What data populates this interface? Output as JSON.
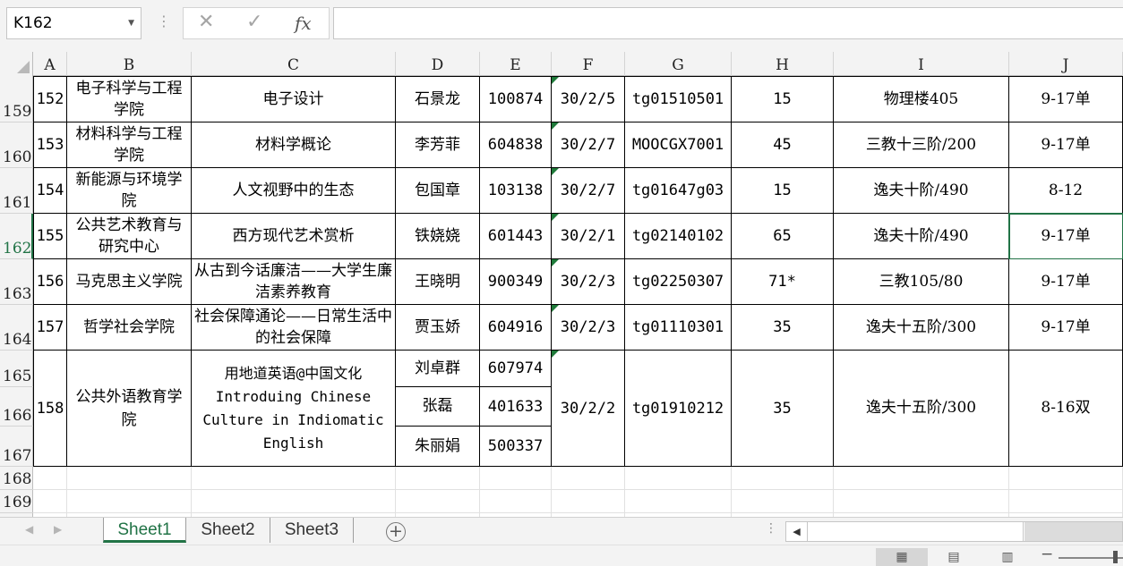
{
  "formula_bar": {
    "name_box": "K162",
    "cancel_icon": "✕",
    "enter_icon": "✓",
    "fx_label": "fx",
    "formula": ""
  },
  "columns": [
    "A",
    "B",
    "C",
    "D",
    "E",
    "F",
    "G",
    "H",
    "I",
    "J"
  ],
  "rows": [
    "159",
    "160",
    "161",
    "162",
    "163",
    "164",
    "165",
    "166",
    "167",
    "168",
    "169"
  ],
  "table": [
    {
      "A": "152",
      "B": "电子科学与工程学院",
      "C": "电子设计",
      "D": "石景龙",
      "E": "100874",
      "F": "30/2/5",
      "G": "tg01510501",
      "H": "15",
      "I": "物理楼405",
      "J": "9-17单"
    },
    {
      "A": "153",
      "B": "材料科学与工程学院",
      "C": "材料学概论",
      "D": "李芳菲",
      "E": "604838",
      "F": "30/2/7",
      "G": "MOOCGX7001",
      "H": "45",
      "I": "三教十三阶/200",
      "J": "9-17单"
    },
    {
      "A": "154",
      "B": "新能源与环境学院",
      "C": "人文视野中的生态",
      "D": "包国章",
      "E": "103138",
      "F": "30/2/7",
      "G": "tg01647g03",
      "H": "15",
      "I": "逸夫十阶/490",
      "J": "8-12"
    },
    {
      "A": "155",
      "B": "公共艺术教育与研究中心",
      "C": "西方现代艺术赏析",
      "D": "铁娆娆",
      "E": "601443",
      "F": "30/2/1",
      "G": "tg02140102",
      "H": "65",
      "I": "逸夫十阶/490",
      "J": "9-17单"
    },
    {
      "A": "156",
      "B": "马克思主义学院",
      "C": "从古到今话廉洁——大学生廉洁素养教育",
      "D": "王晓明",
      "E": "900349",
      "F": "30/2/3",
      "G": "tg02250307",
      "H": "71*",
      "I": "三教105/80",
      "J": "9-17单"
    },
    {
      "A": "157",
      "B": "哲学社会学院",
      "C": "社会保障通论——日常生活中的社会保障",
      "D": "贾玉娇",
      "E": "604916",
      "F": "30/2/3",
      "G": "tg01110301",
      "H": "35",
      "I": "逸夫十五阶/300",
      "J": "9-17单"
    },
    {
      "A": "158",
      "B": "公共外语教育学院",
      "C": "用地道英语@中国文化 Introduing Chinese Culture in Indiomatic English",
      "D": [
        "刘卓群",
        "张磊",
        "朱丽娟"
      ],
      "E": [
        "607974",
        "401633",
        "500337"
      ],
      "F": "30/2/2",
      "G": "tg01910212",
      "H": "35",
      "I": "逸夫十五阶/300",
      "J": "8-16双"
    }
  ],
  "sheets": {
    "tabs": [
      "Sheet1",
      "Sheet2",
      "Sheet3"
    ],
    "active": "Sheet1",
    "add_icon": "+",
    "nav_left": "◀",
    "nav_right": "▶",
    "dots": "⋮"
  },
  "status": {
    "zoom_minus": "−"
  }
}
